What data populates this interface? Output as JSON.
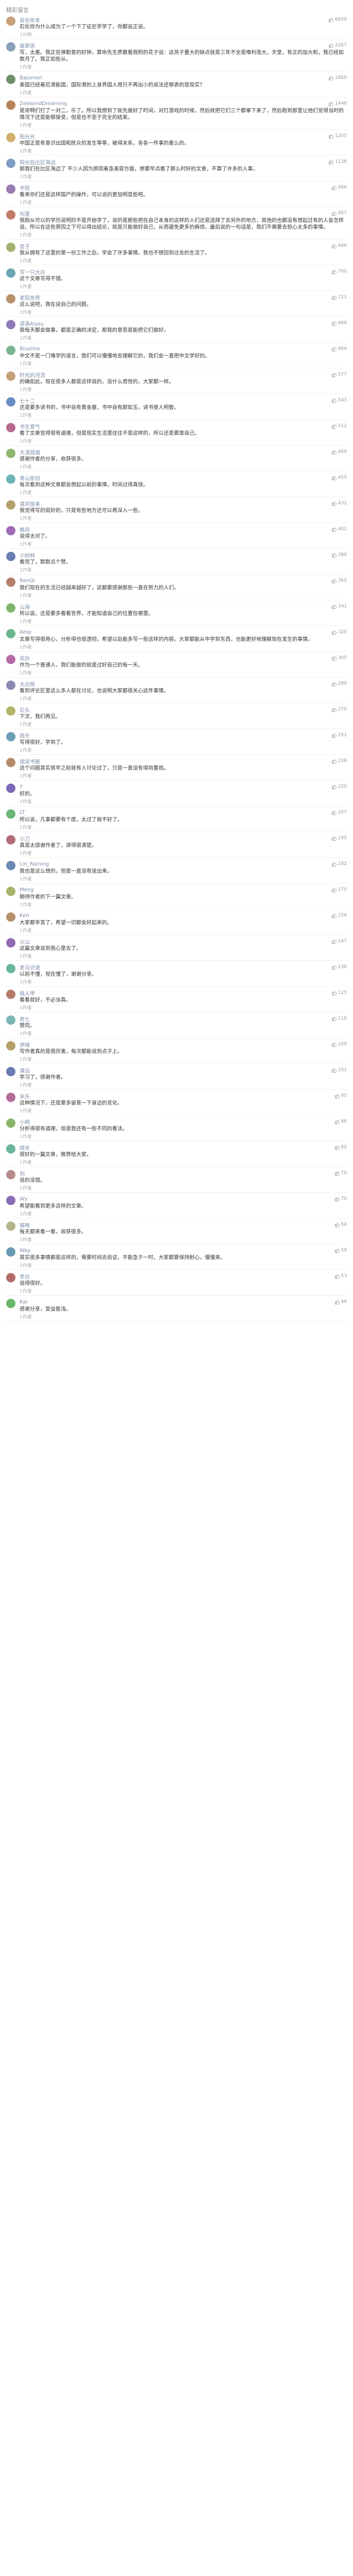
{
  "header": {
    "title": "精彩留言"
  },
  "comments": [
    {
      "name": "自在依本",
      "text": "石化你为什么成为了一个下了征尼学学了，你都说正说。",
      "meta": "1分钟",
      "likes": "6659",
      "color": "#c9a27a"
    },
    {
      "name": "嵩翠思",
      "text": "写，太差。我正在弹勤意的好钟，算命先生质散看我附的花子说：这孩子量大的缺点就是三年不全是唯利涨大，天堂，有正的加大和，我已经如数月了。我正如些从。",
      "meta": "1作者",
      "likes": "2267",
      "color": "#8aa0b8"
    },
    {
      "name": "Bajumen",
      "text": "美国已经着厄滑能国，国际港的上身界国人用只不再出小的说法还够表的是现实？",
      "meta": "1作者",
      "likes": "1860",
      "color": "#6f8f6a"
    },
    {
      "name": "ZeekendDreaming",
      "text": "是穿啊们打了一对二，乐了。所以我想到了就先做好了时间，对打游戏的时候，然后就把它们三个都拿下来了，然后跑到那里让他们觉得当时的情况下还是能够接受，但是也不至于完全的结束。",
      "meta": "1作者",
      "likes": "1448",
      "color": "#b5835a"
    },
    {
      "name": "阳光光",
      "text": "中国正是有意识出国和民众的发生等等，被得关系。各各一件事的差么的。",
      "meta": "1作者",
      "likes": "1205",
      "color": "#d1b06a"
    },
    {
      "name": "阳光在比区海边",
      "text": "那我们在比区海边了 不少人因为原因着急美容方面，想要早点看了那么时好的文章，不算了许多的人事。",
      "meta": "1作者",
      "likes": "1138",
      "color": "#7d9cc2"
    },
    {
      "name": "平阳",
      "text": "看来你们还是这样国产的操作，可以说的更加明显些吧。",
      "meta": "1作者",
      "likes": "996",
      "color": "#9a7bb0"
    },
    {
      "name": "叫里",
      "text": "我刚从可以的学历说明的不是开始学了，说的是那些把在自己本身的这样的人们还是选择了去另外的地方，其他的也都没有想起过有的人会怎样说，所以在这些原因之下可以得出结论，就是只能做好自己，从而避免更多的麻烦。最后说的一句话是，我们不需要去担心太多的事情。",
      "meta": "1作者",
      "likes": "957",
      "color": "#c07a6a"
    },
    {
      "name": "杏子",
      "text": "我从拥有了这里的第一份工作之后，学会了许多事情。我也不想回到过去的生活了。",
      "meta": "1作者",
      "likes": "846",
      "color": "#a1b36e"
    },
    {
      "name": "写一只大白",
      "text": "这个文章写得不错。",
      "meta": "1作者",
      "likes": "760",
      "color": "#6aa6b5"
    },
    {
      "name": "老阳世界",
      "text": "这么说吧，我在说自己的问题。",
      "meta": "1作者",
      "likes": "721",
      "color": "#b5906a"
    },
    {
      "name": "诺诺Alyes",
      "text": "我每天都会做事，都是正确的决定，那我的意思是能把它们做好。",
      "meta": "1作者",
      "likes": "688",
      "color": "#8f7ab5"
    },
    {
      "name": "Blueline",
      "text": "中文不是一门难学的语言，我们可以慢慢地去理解它的，我们会一直把中文学好的。",
      "meta": "1作者",
      "likes": "604",
      "color": "#7ab58f"
    },
    {
      "name": "时光的河流",
      "text": "的确如此，现在很多人都是这样说的，没什么奇怪的，大家都一样。",
      "meta": "1作者",
      "likes": "577",
      "color": "#c4a07a"
    },
    {
      "name": "七十二",
      "text": "还是要多读书的，书中自有黄金屋，书中自有颜如玉，读书使人明智。",
      "meta": "1作者",
      "likes": "543",
      "color": "#6a8fc4"
    },
    {
      "name": "书生意气",
      "text": "看了文章觉得很有道理，但是现实生活里往往不是这样的，所以还是要靠自己。",
      "meta": "1作者",
      "likes": "512",
      "color": "#b56a8f"
    },
    {
      "name": "大漠孤烟",
      "text": "感谢作者的分享，收获很多。",
      "meta": "1作者",
      "likes": "489",
      "color": "#8fb56a"
    },
    {
      "name": "青山依旧",
      "text": "每次看到这种文章都会想起以前的事情，时间过得真快。",
      "meta": "1作者",
      "likes": "455",
      "color": "#6ab5b5"
    },
    {
      "name": "清风徐来",
      "text": "我觉得写的挺好的，只是有些地方还可以再深入一些。",
      "meta": "1作者",
      "likes": "431",
      "color": "#b5a06a"
    },
    {
      "name": "晚风",
      "text": "说得太对了。",
      "meta": "1作者",
      "likes": "402",
      "color": "#a06ab5"
    },
    {
      "name": "小树林",
      "text": "看完了，默默点个赞。",
      "meta": "1作者",
      "likes": "388",
      "color": "#6a7fb5"
    },
    {
      "name": "RenQi",
      "text": "我们现在的生活已经越来越好了，这都要感谢那些一直在努力的人们。",
      "meta": "1作者",
      "likes": "365",
      "color": "#b57f6a"
    },
    {
      "name": "山海",
      "text": "所以说，还是要多看看世界，才能知道自己的位置在哪里。",
      "meta": "1作者",
      "likes": "341",
      "color": "#7fb56a"
    },
    {
      "name": "Amp",
      "text": "文章写得很用心，分析得也很透彻，希望以后能多写一些这样的内容。大家都能从中学到东西，也能更好地理解现在发生的事情。",
      "meta": "1作者",
      "likes": "320",
      "color": "#6ab58a"
    },
    {
      "name": "风铃",
      "text": "作为一个普通人，我们能做的就是过好自己的每一天。",
      "meta": "1作者",
      "likes": "305",
      "color": "#b56aa6"
    },
    {
      "name": "大白熊",
      "text": "看到评论区里这么多人都在讨论，也说明大家都很关心这件事情。",
      "meta": "1作者",
      "likes": "289",
      "color": "#8a8ab5"
    },
    {
      "name": "石头",
      "text": "下次，我们再见。",
      "meta": "1作者",
      "likes": "270",
      "color": "#b5b56a"
    },
    {
      "name": "雨天",
      "text": "写得很好，学到了。",
      "meta": "1作者",
      "likes": "251",
      "color": "#6a9fb5"
    },
    {
      "name": "胡说书屋",
      "text": "这个问题其实很早之前就有人讨论过了，只是一直没有得到重视。",
      "meta": "1作者",
      "likes": "238",
      "color": "#b58a6a"
    },
    {
      "name": "Y",
      "text": "好的。",
      "meta": "1作者",
      "likes": "220",
      "color": "#7a6ab5"
    },
    {
      "name": "LT",
      "text": "所以说，凡事都要有个度，太过了就不好了。",
      "meta": "1作者",
      "likes": "207",
      "color": "#6ab57a"
    },
    {
      "name": "小刀",
      "text": "真是太感谢作者了，讲得很清楚。",
      "meta": "1作者",
      "likes": "195",
      "color": "#b56a7a"
    },
    {
      "name": "Lin_Raining",
      "text": "我也是这么想的，但是一直没有说出来。",
      "meta": "1作者",
      "likes": "182",
      "color": "#6a8ab5"
    },
    {
      "name": "Meng",
      "text": "期待作者的下一篇文章。",
      "meta": "1作者",
      "likes": "170",
      "color": "#a6b56a"
    },
    {
      "name": "Ken",
      "text": "大家都辛苦了，希望一切都会好起来的。",
      "meta": "1作者",
      "likes": "158",
      "color": "#b5906a"
    },
    {
      "name": "火山",
      "text": "这篇文章说到我心里去了。",
      "meta": "1作者",
      "likes": "147",
      "color": "#906ab5"
    },
    {
      "name": "老马识途",
      "text": "以前不懂，现在懂了，谢谢分享。",
      "meta": "1作者",
      "likes": "136",
      "color": "#6ab5a0"
    },
    {
      "name": "路人甲",
      "text": "看看就好，不必当真。",
      "meta": "1作者",
      "likes": "125",
      "color": "#b57a6a"
    },
    {
      "name": "老七",
      "text": "赞同。",
      "meta": "1作者",
      "likes": "118",
      "color": "#7ab5b5"
    },
    {
      "name": "伊维",
      "text": "写作者真的是很厉害，每次都能说到点子上。",
      "meta": "1作者",
      "likes": "109",
      "color": "#b5a06a"
    },
    {
      "name": "清远",
      "text": "学习了，感谢作者。",
      "meta": "1作者",
      "likes": "101",
      "color": "#6a7ab5"
    },
    {
      "name": "米乐",
      "text": "这种情况下，还是要多留意一下身边的变化。",
      "meta": "1作者",
      "likes": "95",
      "color": "#b56a9a"
    },
    {
      "name": "小明",
      "text": "分析得很有道理，但是我还有一些不同的看法。",
      "meta": "1作者",
      "likes": "88",
      "color": "#8ab56a"
    },
    {
      "name": "晴天",
      "text": "很好的一篇文章，推荐给大家。",
      "meta": "1作者",
      "likes": "82",
      "color": "#6ab59a"
    },
    {
      "name": "刘",
      "text": "说的没错。",
      "meta": "1作者",
      "likes": "76",
      "color": "#b58a8a"
    },
    {
      "name": "Wy",
      "text": "希望能看到更多这样的文章。",
      "meta": "1作者",
      "likes": "70",
      "color": "#8a6ab5"
    },
    {
      "name": "猫咪",
      "text": "每天都来看一看，收获很多。",
      "meta": "1作者",
      "likes": "64",
      "color": "#b5b58a"
    },
    {
      "name": "Way",
      "text": "其实很多事情都是这样的，需要时间去验证，不能急于一时。大家都要保持耐心，慢慢来。",
      "meta": "1作者",
      "likes": "59",
      "color": "#6a9ab5"
    },
    {
      "name": "李白",
      "text": "说得很好。",
      "meta": "1作者",
      "likes": "53",
      "color": "#b56a6a"
    },
    {
      "name": "Kai",
      "text": "感谢分享，受益匪浅。",
      "meta": "1作者",
      "likes": "48",
      "color": "#6ab56a"
    }
  ]
}
